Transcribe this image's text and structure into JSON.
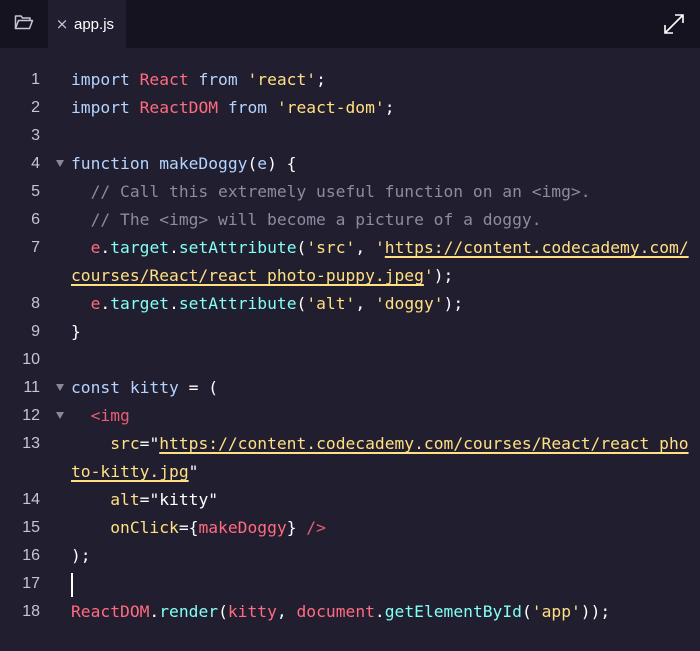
{
  "tab": {
    "close": "×",
    "filename": "app.js"
  },
  "icons": {
    "folder": "folder-icon",
    "expand": "expand-icon"
  },
  "colors": {
    "background": "#211e2f",
    "tabbar": "#15131f",
    "keyword": "#b4d4ff",
    "identifier": "#ff6c7f",
    "string": "#ffe083",
    "comment": "#8e8ba0",
    "method": "#83fff5",
    "jsx_tag": "#e85d75"
  },
  "lines": [
    {
      "n": "1",
      "fold": false,
      "tokens": [
        {
          "c": "kw",
          "t": "import "
        },
        {
          "c": "id",
          "t": "React"
        },
        {
          "c": "kw",
          "t": " from "
        },
        {
          "c": "str",
          "t": "'react'"
        },
        {
          "c": "",
          "t": ";"
        }
      ]
    },
    {
      "n": "2",
      "fold": false,
      "tokens": [
        {
          "c": "kw",
          "t": "import "
        },
        {
          "c": "id",
          "t": "ReactDOM"
        },
        {
          "c": "kw",
          "t": " from "
        },
        {
          "c": "str",
          "t": "'react-dom'"
        },
        {
          "c": "",
          "t": ";"
        }
      ]
    },
    {
      "n": "3",
      "fold": false,
      "tokens": []
    },
    {
      "n": "4",
      "fold": true,
      "tokens": [
        {
          "c": "kw",
          "t": "function makeDoggy"
        },
        {
          "c": "",
          "t": "("
        },
        {
          "c": "kw",
          "t": "e"
        },
        {
          "c": "",
          "t": ") {"
        }
      ]
    },
    {
      "n": "5",
      "fold": false,
      "tokens": [
        {
          "c": "cm",
          "t": "  // Call this extremely useful function on an <img>."
        }
      ]
    },
    {
      "n": "6",
      "fold": false,
      "tokens": [
        {
          "c": "cm",
          "t": "  // The <img> will become a picture of a doggy."
        }
      ]
    },
    {
      "n": "7",
      "fold": false,
      "tokens": [
        {
          "c": "id",
          "t": "  e"
        },
        {
          "c": "",
          "t": "."
        },
        {
          "c": "fn",
          "t": "target"
        },
        {
          "c": "",
          "t": "."
        },
        {
          "c": "fn",
          "t": "setAttribute"
        },
        {
          "c": "",
          "t": "("
        },
        {
          "c": "str",
          "t": "'src'"
        },
        {
          "c": "",
          "t": ", "
        },
        {
          "c": "str",
          "t": "'"
        },
        {
          "c": "url",
          "t": "https://content.codecademy.com/courses/React/react_photo-puppy.jpeg"
        },
        {
          "c": "str",
          "t": "'"
        },
        {
          "c": "",
          "t": ");"
        }
      ]
    },
    {
      "n": "8",
      "fold": false,
      "tokens": [
        {
          "c": "id",
          "t": "  e"
        },
        {
          "c": "",
          "t": "."
        },
        {
          "c": "fn",
          "t": "target"
        },
        {
          "c": "",
          "t": "."
        },
        {
          "c": "fn",
          "t": "setAttribute"
        },
        {
          "c": "",
          "t": "("
        },
        {
          "c": "str",
          "t": "'alt'"
        },
        {
          "c": "",
          "t": ", "
        },
        {
          "c": "str",
          "t": "'doggy'"
        },
        {
          "c": "",
          "t": ");"
        }
      ]
    },
    {
      "n": "9",
      "fold": false,
      "tokens": [
        {
          "c": "",
          "t": "}"
        }
      ]
    },
    {
      "n": "10",
      "fold": false,
      "tokens": []
    },
    {
      "n": "11",
      "fold": true,
      "tokens": [
        {
          "c": "kw",
          "t": "const kitty "
        },
        {
          "c": "",
          "t": "= ("
        }
      ]
    },
    {
      "n": "12",
      "fold": true,
      "tokens": [
        {
          "c": "tag",
          "t": "  <img"
        }
      ]
    },
    {
      "n": "13",
      "fold": false,
      "tokens": [
        {
          "c": "str",
          "t": "    src"
        },
        {
          "c": "",
          "t": "=\""
        },
        {
          "c": "url",
          "t": "https://content.codecademy.com/courses/React/react_photo-kitty.jpg"
        },
        {
          "c": "",
          "t": "\""
        }
      ]
    },
    {
      "n": "14",
      "fold": false,
      "tokens": [
        {
          "c": "str",
          "t": "    alt"
        },
        {
          "c": "",
          "t": "=\"kitty\""
        }
      ]
    },
    {
      "n": "15",
      "fold": false,
      "tokens": [
        {
          "c": "str",
          "t": "    onClick"
        },
        {
          "c": "",
          "t": "={"
        },
        {
          "c": "id",
          "t": "makeDoggy"
        },
        {
          "c": "",
          "t": "} "
        },
        {
          "c": "tag",
          "t": "/>"
        }
      ]
    },
    {
      "n": "16",
      "fold": false,
      "tokens": [
        {
          "c": "",
          "t": ");"
        }
      ]
    },
    {
      "n": "17",
      "fold": false,
      "cursor": true,
      "tokens": []
    },
    {
      "n": "18",
      "fold": false,
      "tokens": [
        {
          "c": "id",
          "t": "ReactDOM"
        },
        {
          "c": "",
          "t": "."
        },
        {
          "c": "fn",
          "t": "render"
        },
        {
          "c": "",
          "t": "("
        },
        {
          "c": "id",
          "t": "kitty"
        },
        {
          "c": "",
          "t": ", "
        },
        {
          "c": "id",
          "t": "document"
        },
        {
          "c": "",
          "t": "."
        },
        {
          "c": "fn",
          "t": "getElementById"
        },
        {
          "c": "",
          "t": "("
        },
        {
          "c": "str",
          "t": "'app'"
        },
        {
          "c": "",
          "t": "));"
        }
      ]
    }
  ]
}
